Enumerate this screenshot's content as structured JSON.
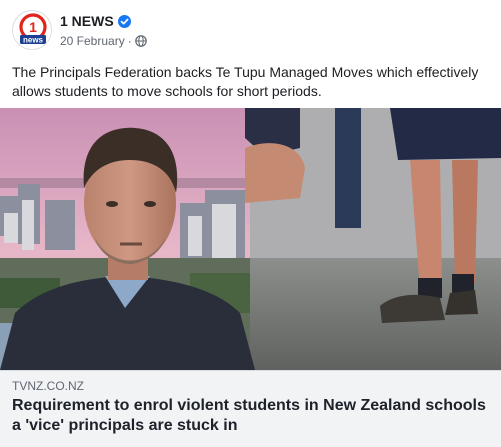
{
  "post": {
    "page_name": "1 NEWS",
    "date": "20 February",
    "separator": "·",
    "text": "The Principals Federation backs Te Tupu Managed Moves which effectively allows students to move schools for short periods.",
    "logo_text": "news",
    "logo_number": "1"
  },
  "link_preview": {
    "domain": "TVNZ.CO.NZ",
    "headline": "Requirement to enrol violent students in New Zealand schools a 'vice' principals are stuck in"
  },
  "icons": {
    "verified": "verified-badge-icon",
    "privacy": "globe-icon"
  },
  "colors": {
    "verified_blue": "#1877f2",
    "logo_red": "#e2231a",
    "logo_blue": "#1c3f94",
    "link_bg": "#f2f3f5",
    "meta_grey": "#606770"
  }
}
